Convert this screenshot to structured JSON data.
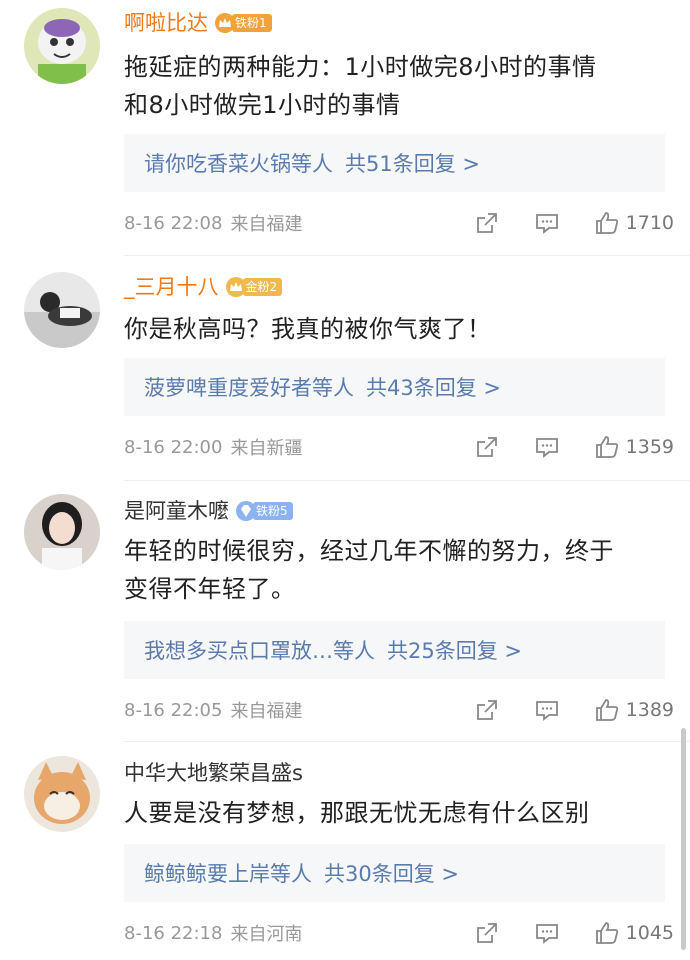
{
  "comments": [
    {
      "username": "啊啦比达",
      "badge": "铁粉1",
      "text_lines": [
        "拖延症的两种能力：1小时做完8小时的事情",
        "和8小时做完1小时的事情"
      ],
      "reply_preview": "请你吃香菜火锅等人",
      "reply_count": "共51条回复 >",
      "timestamp": "8-16 22:08",
      "location": "来自福建",
      "likes": "1710"
    },
    {
      "username": "_三月十八",
      "badge": "金粉2",
      "text_lines": [
        "你是秋高吗？我真的被你气爽了！"
      ],
      "reply_preview": "菠萝啤重度爱好者等人",
      "reply_count": "共43条回复 >",
      "timestamp": "8-16 22:00",
      "location": "来自新疆",
      "likes": "1359"
    },
    {
      "username": "是阿童木嚒",
      "badge": "铁粉5",
      "text_lines": [
        "年轻的时候很穷，经过几年不懈的努力，终于",
        "变得不年轻了。"
      ],
      "reply_preview": "我想多买点口罩放…等人",
      "reply_count": "共25条回复 >",
      "timestamp": "8-16 22:05",
      "location": "来自福建",
      "likes": "1389"
    },
    {
      "username": "中华大地繁荣昌盛s",
      "text_lines": [
        "人要是没有梦想，那跟无忧无虑有什么区别"
      ],
      "reply_preview": "鲸鲸鲸要上岸等人",
      "reply_count": "共30条回复 >",
      "timestamp": "8-16 22:18",
      "location": "来自河南",
      "likes": "1045"
    }
  ],
  "icons": {
    "share": "share-icon",
    "comment": "comment-icon",
    "like": "thumbs-up-icon"
  },
  "colors": {
    "vip_name": "#f07a18",
    "reply_link": "#5b7bad",
    "meta": "#999999"
  }
}
